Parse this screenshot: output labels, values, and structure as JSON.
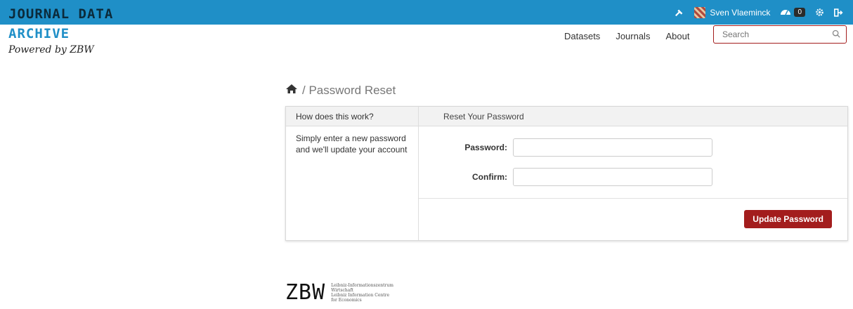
{
  "brand": {
    "logo_line1": "JOURNAL DATA",
    "logo_line2": "ARCHIVE",
    "powered": "Powered by ZBW",
    "topbar_color": "#1f8fc7",
    "accent_color": "#a31d1d"
  },
  "userbar": {
    "username": "Sven Vlaeminck",
    "notifications": "0"
  },
  "nav": {
    "items": [
      "Datasets",
      "Journals",
      "About"
    ]
  },
  "search": {
    "placeholder": "Search"
  },
  "breadcrumb": {
    "current": "Password Reset"
  },
  "card": {
    "left_header": "How does this work?",
    "left_text": "Simply enter a new password and we'll update your account",
    "right_header": "Reset Your Password",
    "password_label": "Password:",
    "confirm_label": "Confirm:",
    "submit_label": "Update Password"
  },
  "footer": {
    "logo": "ZBW",
    "line1": "Leibniz-Informationszentrum",
    "line2": "Wirtschaft",
    "line3": "Leibniz Information Centre",
    "line4": "for Economics"
  }
}
